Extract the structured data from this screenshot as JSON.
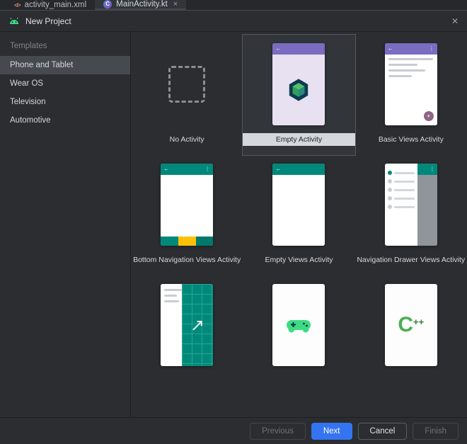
{
  "editor_tabs": {
    "tabs": [
      {
        "label": "activity_main.xml"
      },
      {
        "label": "MainActivity.kt",
        "close": "×"
      }
    ]
  },
  "dialog": {
    "title": "New Project",
    "close_icon": "✕"
  },
  "sidebar": {
    "header": "Templates",
    "items": [
      {
        "label": "Phone and Tablet",
        "selected": true
      },
      {
        "label": "Wear OS",
        "selected": false
      },
      {
        "label": "Television",
        "selected": false
      },
      {
        "label": "Automotive",
        "selected": false
      }
    ]
  },
  "templates": {
    "cards": [
      {
        "label": "No Activity",
        "selected": false
      },
      {
        "label": "Empty Activity",
        "selected": true
      },
      {
        "label": "Basic Views Activity",
        "selected": false
      },
      {
        "label": "Bottom Navigation Views Activity",
        "selected": false
      },
      {
        "label": "Empty Views Activity",
        "selected": false
      },
      {
        "label": "Navigation Drawer Views Activity",
        "selected": false
      }
    ]
  },
  "glyphs": {
    "back_arrow": "←",
    "kebab_menu": "⋮",
    "plus": "+",
    "arrow_up_right": "↗",
    "xml_tag": "</>",
    "kotlin_class": "C",
    "cpp_c": "C",
    "cpp_pp": "++"
  },
  "footer": {
    "previous_label": "Previous",
    "next_label": "Next",
    "cancel_label": "Cancel",
    "finish_label": "Finish"
  },
  "colors": {
    "accent_blue": "#3574f0",
    "teal": "#00897b",
    "yellow": "#ffc107",
    "purple": "#7a6cc0",
    "android_green": "#3ddc84"
  }
}
